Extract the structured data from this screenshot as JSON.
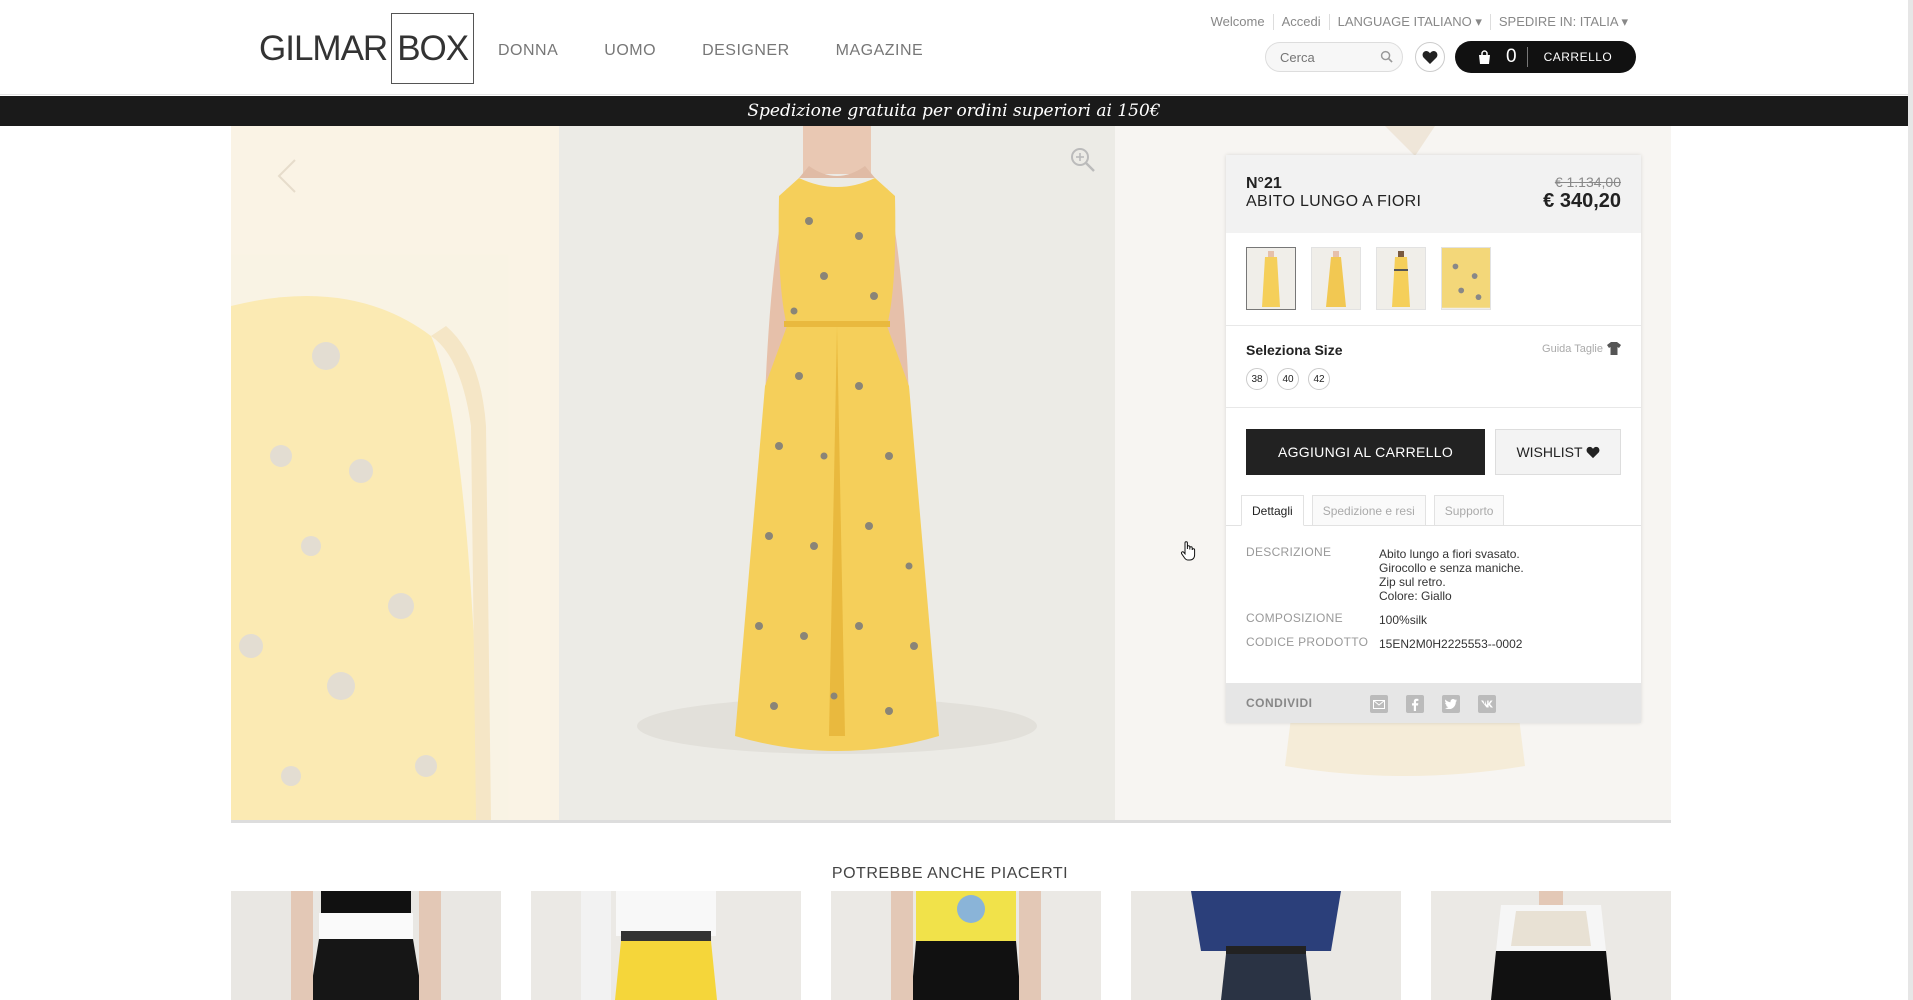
{
  "header": {
    "logo_part1": "GILMAR",
    "logo_part2": "BOX",
    "nav": [
      "DONNA",
      "UOMO",
      "DESIGNER",
      "MAGAZINE"
    ],
    "toplinks": [
      "Welcome",
      "Accedi",
      "LANGUAGE ITALIANO ▾",
      "SPEDIRE IN: ITALIA ▾"
    ],
    "search_placeholder": "Cerca",
    "cart_count": "0",
    "cart_label": "CARRELLO"
  },
  "promo": "Spedizione gratuita per ordini superiori ai 150€",
  "product": {
    "number": "N°21",
    "name": "ABITO LUNGO A FIORI",
    "old_price": "€ 1.134,00",
    "price": "€ 340,20",
    "size_title": "Seleziona Size",
    "size_guide": "Guida Taglie",
    "sizes": [
      "38",
      "40",
      "42"
    ],
    "add_to_cart": "AGGIUNGI AL CARRELLO",
    "wishlist": "WISHLIST",
    "tabs": [
      "Dettagli",
      "Spedizione e resi",
      "Supporto"
    ],
    "details": {
      "description_label": "DESCRIZIONE",
      "description": [
        "Abito lungo a fiori svasato.",
        "Girocollo e senza maniche.",
        "Zip sul retro.",
        "Colore: Giallo"
      ],
      "composition_label": "COMPOSIZIONE",
      "composition": "100%silk",
      "code_label": "CODICE PRODOTTO",
      "code": "15EN2M0H2225553--0002"
    },
    "share_label": "CONDIVIDI"
  },
  "related": {
    "title": "POTREBBE ANCHE PIACERTI"
  },
  "colors": {
    "dress": "#f5cf5a",
    "dress_shadow": "#e9b93e",
    "dark": "#111111"
  }
}
